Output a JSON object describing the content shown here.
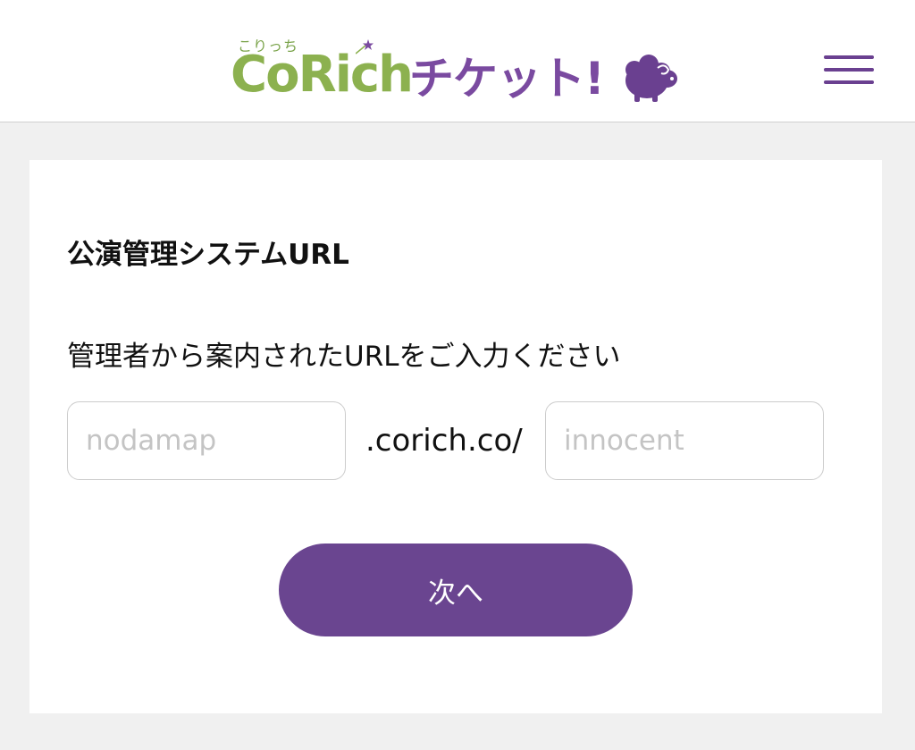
{
  "header": {
    "logo": {
      "ruby_text": "こりっち",
      "brand_text": "CoRich",
      "ticket_text": "チケット!",
      "mascot_icon": "sheep-icon"
    },
    "menu_icon": "hamburger-menu-icon"
  },
  "form": {
    "title": "公演管理システムURL",
    "instruction": "管理者から案内されたURLをご入力ください",
    "subdomain_placeholder": "nodamap",
    "subdomain_value": "",
    "domain_text": ".corich.co/",
    "path_placeholder": "innocent",
    "path_value": "",
    "next_button_label": "次へ"
  },
  "colors": {
    "brand_green": "#8cb14f",
    "brand_purple": "#7a4aa0",
    "button_purple": "#6a4590",
    "page_background": "#f0f0f0"
  }
}
